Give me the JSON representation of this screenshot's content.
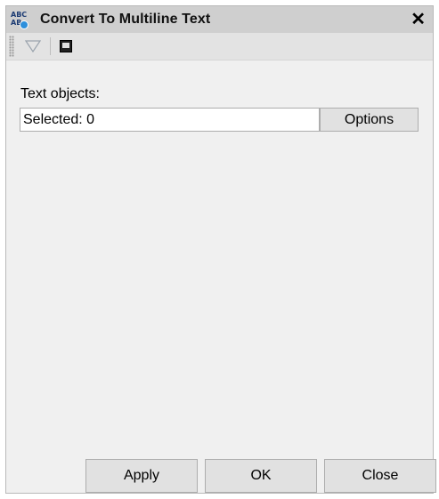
{
  "window": {
    "title": "Convert To Multiline Text",
    "close_glyph": "✕",
    "app_icon": {
      "name": "abc-text-convert-icon",
      "line1": "ABC",
      "line2": "AB"
    }
  },
  "toolbar": {
    "items": [
      {
        "name": "filter-icon"
      },
      {
        "name": "console-icon"
      }
    ]
  },
  "main": {
    "section_label": "Text objects:",
    "selection_field_value": "Selected: 0",
    "options_label": "Options"
  },
  "footer": {
    "apply_label": "Apply",
    "ok_label": "OK",
    "close_label": "Close"
  },
  "colors": {
    "titlebar": "#cfcfcf",
    "window_bg": "#f0f0f0",
    "button_bg": "#e1e1e1",
    "accent_badge": "#2d8fdc"
  }
}
